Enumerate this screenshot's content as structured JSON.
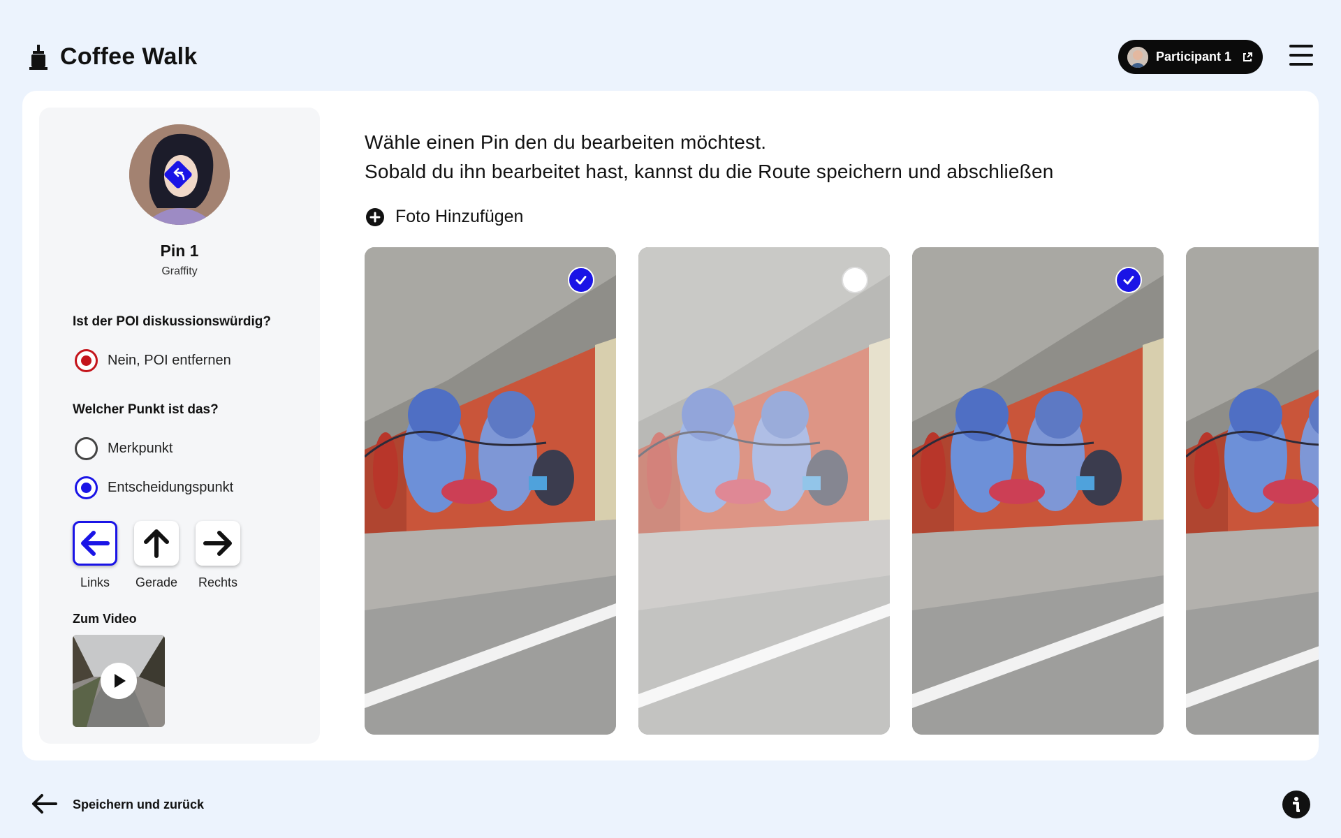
{
  "app": {
    "title": "Coffee Walk"
  },
  "header": {
    "participant_label": "Participant 1",
    "participant_icon": "external-link-icon",
    "menu_icon": "hamburger-menu-icon"
  },
  "pin": {
    "title": "Pin 1",
    "category": "Graffity",
    "question_discuss": "Ist der POI diskussionswürdig?",
    "discuss_option": {
      "label": "Nein, POI entfernen",
      "selected": true,
      "color": "#c4151c"
    },
    "question_type": "Welcher Punkt ist das?",
    "type_options": [
      {
        "label": "Merkpunkt",
        "selected": false
      },
      {
        "label": "Entscheidungspunkt",
        "selected": true
      }
    ],
    "directions": [
      {
        "label": "Links",
        "icon": "arrow-left-icon",
        "selected": true
      },
      {
        "label": "Gerade",
        "icon": "arrow-up-icon",
        "selected": false
      },
      {
        "label": "Rechts",
        "icon": "arrow-right-icon",
        "selected": false
      }
    ],
    "video_label": "Zum Video"
  },
  "content": {
    "instruction_line1": "Wähle einen Pin den du bearbeiten möchtest.",
    "instruction_line2": "Sobald du ihn bearbeitet hast, kannst du die Route speichern und abschließen",
    "add_photo_label": "Foto Hinzufügen",
    "photos": [
      {
        "selected": true
      },
      {
        "selected": false
      },
      {
        "selected": true
      },
      {
        "selected": false
      }
    ]
  },
  "footer": {
    "back_label": "Speichern und zurück",
    "info_icon": "info-icon"
  },
  "colors": {
    "accent": "#1a14e6",
    "danger": "#c4151c",
    "background": "#ecf3fd"
  }
}
